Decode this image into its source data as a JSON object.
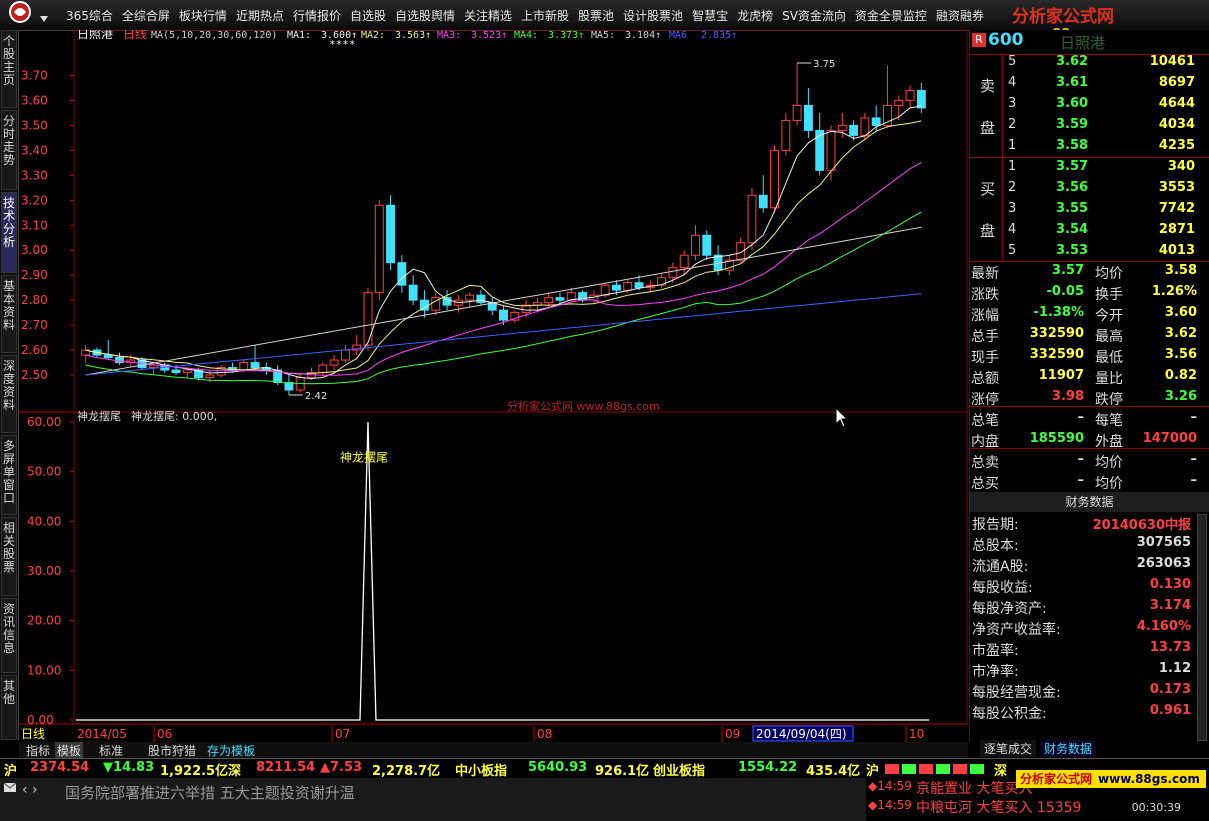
{
  "menu": {
    "items": [
      "365综合",
      "全综合屏",
      "板块行情",
      "近期热点",
      "行情报价",
      "自选股",
      "自选股舆情",
      "关注精选",
      "上市新股",
      "股票池",
      "设计股票池",
      "智慧宝",
      "龙虎榜",
      "SV资金流向",
      "资金全景监控",
      "融资融券"
    ]
  },
  "brand": {
    "title": "分析家公式网",
    "url": "www.88gs.com"
  },
  "left_tabs": [
    "个股主页",
    "分时走势",
    "技术分析",
    "基本资料",
    "深度资料",
    "多屏单窗口",
    "相关股票",
    "资讯信息",
    "其他"
  ],
  "chart_header": {
    "name": "日照港",
    "period": "日线",
    "ma_params": "MA(5,10,20,30,60,120)",
    "ma": [
      {
        "label": "MA1:",
        "value": "3.600↑",
        "color": "#f0f0f0"
      },
      {
        "label": "MA2:",
        "value": "3.563↑",
        "color": "#f0f080"
      },
      {
        "label": "MA3:",
        "value": "3.523↑",
        "color": "#ff40ff"
      },
      {
        "label": "MA4:",
        "value": "3.373↑",
        "color": "#40ff40"
      },
      {
        "label": "MA5:",
        "value": "3.104↑",
        "color": "#d0d0d0"
      },
      {
        "label": "MA6",
        "value": "2.835↑",
        "color": "#4060ff"
      }
    ],
    "stars": "****",
    "high_mark": "3.75",
    "low_mark": "2.42"
  },
  "price_axis": [
    "3.70",
    "3.60",
    "3.50",
    "3.40",
    "3.30",
    "3.20",
    "3.10",
    "3.00",
    "2.90",
    "2.80",
    "2.70",
    "2.60",
    "2.50"
  ],
  "watermark": "分析家公式网 www.88gs.com",
  "indicator": {
    "name": "神龙摆尾",
    "value_label": "神龙摆尾: 0.000,",
    "annotation": "神龙摆尾",
    "axis": [
      "60.00",
      "50.00",
      "40.00",
      "30.00",
      "20.00",
      "10.00",
      "0.00"
    ]
  },
  "date_axis": {
    "labels": [
      "2014/05",
      "06",
      "07",
      "08",
      "09",
      "10"
    ],
    "selected": "2014/09/04(四)"
  },
  "chart_data": {
    "type": "candlestick",
    "title": "日照港",
    "ylim": [
      2.42,
      3.75
    ],
    "candles": [
      [
        2.58,
        2.62,
        2.55,
        2.6
      ],
      [
        2.6,
        2.61,
        2.57,
        2.58
      ],
      [
        2.58,
        2.64,
        2.56,
        2.57
      ],
      [
        2.57,
        2.59,
        2.54,
        2.55
      ],
      [
        2.55,
        2.58,
        2.53,
        2.56
      ],
      [
        2.56,
        2.57,
        2.52,
        2.53
      ],
      [
        2.53,
        2.55,
        2.5,
        2.54
      ],
      [
        2.54,
        2.55,
        2.51,
        2.52
      ],
      [
        2.52,
        2.54,
        2.5,
        2.51
      ],
      [
        2.51,
        2.53,
        2.49,
        2.52
      ],
      [
        2.52,
        2.53,
        2.48,
        2.49
      ],
      [
        2.49,
        2.52,
        2.47,
        2.5
      ],
      [
        2.5,
        2.54,
        2.49,
        2.53
      ],
      [
        2.53,
        2.55,
        2.51,
        2.52
      ],
      [
        2.52,
        2.56,
        2.51,
        2.55
      ],
      [
        2.55,
        2.62,
        2.54,
        2.53
      ],
      [
        2.53,
        2.55,
        2.5,
        2.52
      ],
      [
        2.52,
        2.54,
        2.46,
        2.47
      ],
      [
        2.47,
        2.5,
        2.42,
        2.44
      ],
      [
        2.44,
        2.5,
        2.43,
        2.49
      ],
      [
        2.49,
        2.53,
        2.48,
        2.51
      ],
      [
        2.51,
        2.55,
        2.5,
        2.54
      ],
      [
        2.54,
        2.58,
        2.52,
        2.56
      ],
      [
        2.56,
        2.62,
        2.55,
        2.6
      ],
      [
        2.6,
        2.66,
        2.58,
        2.62
      ],
      [
        2.62,
        2.85,
        2.6,
        2.83
      ],
      [
        2.83,
        3.2,
        2.8,
        3.18
      ],
      [
        3.18,
        3.22,
        2.92,
        2.95
      ],
      [
        2.95,
        2.98,
        2.83,
        2.86
      ],
      [
        2.86,
        2.9,
        2.78,
        2.8
      ],
      [
        2.8,
        2.84,
        2.73,
        2.76
      ],
      [
        2.76,
        2.83,
        2.74,
        2.81
      ],
      [
        2.81,
        2.84,
        2.76,
        2.78
      ],
      [
        2.78,
        2.82,
        2.75,
        2.8
      ],
      [
        2.8,
        2.83,
        2.77,
        2.82
      ],
      [
        2.82,
        2.84,
        2.78,
        2.79
      ],
      [
        2.79,
        2.81,
        2.74,
        2.76
      ],
      [
        2.76,
        2.78,
        2.7,
        2.72
      ],
      [
        2.72,
        2.76,
        2.71,
        2.75
      ],
      [
        2.75,
        2.8,
        2.73,
        2.78
      ],
      [
        2.78,
        2.81,
        2.75,
        2.79
      ],
      [
        2.79,
        2.83,
        2.77,
        2.81
      ],
      [
        2.81,
        2.83,
        2.78,
        2.8
      ],
      [
        2.8,
        2.85,
        2.79,
        2.83
      ],
      [
        2.83,
        2.84,
        2.79,
        2.8
      ],
      [
        2.8,
        2.84,
        2.79,
        2.82
      ],
      [
        2.82,
        2.87,
        2.81,
        2.86
      ],
      [
        2.86,
        2.88,
        2.82,
        2.84
      ],
      [
        2.84,
        2.88,
        2.83,
        2.87
      ],
      [
        2.87,
        2.9,
        2.84,
        2.85
      ],
      [
        2.85,
        2.88,
        2.83,
        2.86
      ],
      [
        2.86,
        2.91,
        2.85,
        2.89
      ],
      [
        2.89,
        2.95,
        2.87,
        2.93
      ],
      [
        2.93,
        3.0,
        2.9,
        2.98
      ],
      [
        2.98,
        3.1,
        2.96,
        3.06
      ],
      [
        3.06,
        3.08,
        2.96,
        2.98
      ],
      [
        2.98,
        3.02,
        2.9,
        2.92
      ],
      [
        2.92,
        2.98,
        2.9,
        2.96
      ],
      [
        2.96,
        3.05,
        2.95,
        3.03
      ],
      [
        3.03,
        3.25,
        3.0,
        3.22
      ],
      [
        3.22,
        3.3,
        3.15,
        3.17
      ],
      [
        3.17,
        3.42,
        3.15,
        3.4
      ],
      [
        3.4,
        3.55,
        3.38,
        3.52
      ],
      [
        3.52,
        3.75,
        3.5,
        3.58
      ],
      [
        3.58,
        3.65,
        3.45,
        3.48
      ],
      [
        3.48,
        3.55,
        3.3,
        3.32
      ],
      [
        3.32,
        3.5,
        3.28,
        3.48
      ],
      [
        3.48,
        3.55,
        3.45,
        3.5
      ],
      [
        3.5,
        3.52,
        3.44,
        3.46
      ],
      [
        3.46,
        3.55,
        3.44,
        3.53
      ],
      [
        3.53,
        3.58,
        3.48,
        3.5
      ],
      [
        3.5,
        3.74,
        3.49,
        3.58
      ],
      [
        3.58,
        3.62,
        3.52,
        3.6
      ],
      [
        3.6,
        3.66,
        3.57,
        3.64
      ],
      [
        3.64,
        3.67,
        3.55,
        3.57
      ]
    ],
    "indicator_values": {
      "spike_index": 25,
      "spike_value": 60.0,
      "ylim": [
        0,
        60
      ]
    }
  },
  "bottom_tabs": {
    "period": "日线",
    "tabs": [
      "指标",
      "模板",
      "标准",
      "股市狩猎",
      "存为模板"
    ]
  },
  "quote": {
    "code": "600",
    "name": "日照港",
    "asks": [
      {
        "n": "5",
        "p": "3.62",
        "v": "10461"
      },
      {
        "n": "4",
        "p": "3.61",
        "v": "8697"
      },
      {
        "n": "3",
        "p": "3.60",
        "v": "4644"
      },
      {
        "n": "2",
        "p": "3.59",
        "v": "4034"
      },
      {
        "n": "1",
        "p": "3.58",
        "v": "4235"
      }
    ],
    "bids": [
      {
        "n": "1",
        "p": "3.57",
        "v": "340"
      },
      {
        "n": "2",
        "p": "3.56",
        "v": "3553"
      },
      {
        "n": "3",
        "p": "3.55",
        "v": "7742"
      },
      {
        "n": "4",
        "p": "3.54",
        "v": "2871"
      },
      {
        "n": "5",
        "p": "3.53",
        "v": "4013"
      }
    ],
    "ask_label": [
      "卖",
      "盘"
    ],
    "bid_label": [
      "买",
      "盘"
    ],
    "stats": [
      [
        "最新",
        "3.57",
        "均价",
        "3.58"
      ],
      [
        "涨跌",
        "-0.05",
        "换手",
        "1.26%"
      ],
      [
        "涨幅",
        "-1.38%",
        "今开",
        "3.60"
      ],
      [
        "总手",
        "332590",
        "最高",
        "3.62"
      ],
      [
        "现手",
        "332590",
        "最低",
        "3.56"
      ],
      [
        "总额",
        "11907",
        "量比",
        "0.82"
      ],
      [
        "涨停",
        "3.98",
        "跌停",
        "3.26"
      ],
      [
        "总笔",
        "–",
        "每笔",
        "–"
      ],
      [
        "内盘",
        "185590",
        "外盘",
        "147000"
      ],
      [
        "总卖",
        "–",
        "均价",
        "–"
      ],
      [
        "总买",
        "–",
        "均价",
        "–"
      ]
    ]
  },
  "finance": {
    "header": "财务数据",
    "rows": [
      [
        "报告期:",
        "20140630中报"
      ],
      [
        "总股本:",
        "307565"
      ],
      [
        "流通A股:",
        "263063"
      ],
      [
        "每股收益:",
        "0.130"
      ],
      [
        "每股净资产:",
        "3.174"
      ],
      [
        "净资产收益率:",
        "4.160%"
      ],
      [
        "市盈率:",
        "13.73"
      ],
      [
        "市净率:",
        "1.12"
      ],
      [
        "每股经营现金:",
        "0.173"
      ],
      [
        "每股公积金:",
        "0.961"
      ]
    ],
    "tabs": [
      "逐笔成交",
      "财务数据"
    ]
  },
  "index_bar": {
    "sh_label": "沪",
    "sh_val": "2374.54",
    "sh_chg": "▼14.83",
    "sh_amt": "1,922.5亿",
    "sz_label": "深",
    "sz_val": "8211.54",
    "sz_chg": "▲7.53",
    "sz_amt": "2,278.7亿",
    "zxb_label": "中小板指",
    "zxb_val": "5640.93",
    "zxb_amt": "926.1亿",
    "cyb_label": "创业板指",
    "cyb_val": "1554.22",
    "cyb_amt": "435.4亿",
    "sh2": "沪",
    "sz2": "深"
  },
  "news": "国务院部署推进六举措 五大主题投资谢升温",
  "ticks": [
    {
      "time": "◆14:59",
      "text": "京能置业 大笔买入"
    },
    {
      "time": "◆14:59",
      "text": "中粮屯河 大笔买入 15359"
    }
  ],
  "clock": "00:30:39",
  "colors": {
    "up": "#ff4040",
    "down": "#40e0ff",
    "panel_border": "#800000"
  }
}
